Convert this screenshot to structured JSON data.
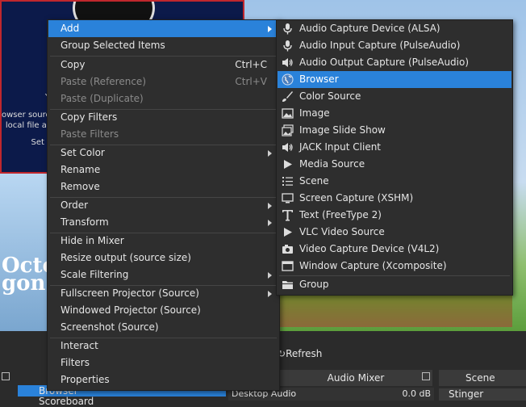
{
  "background": {
    "left_panel_lines": [
      "Y",
      "owser source",
      "local file ar",
      "Set t"
    ],
    "logo_lines": [
      "Octo",
      "gon"
    ],
    "refresh_label": "Refresh",
    "audio_mixer_title": "Audio Mixer",
    "scene_transitions_title": "Scene Transiti",
    "sources": [
      "Browser",
      "Scoreboard"
    ],
    "desktop_audio": {
      "label": "Desktop Audio",
      "level": "0.0 dB"
    },
    "transition_selected": "Stinger"
  },
  "context_menu": {
    "items": [
      {
        "label": "Add",
        "submenu": true,
        "highlighted": true
      },
      {
        "label": "Group Selected Items"
      },
      {
        "label": "Copy",
        "shortcut": "Ctrl+C"
      },
      {
        "label": "Paste (Reference)",
        "shortcut": "Ctrl+V",
        "disabled": true
      },
      {
        "label": "Paste (Duplicate)",
        "disabled": true
      },
      {
        "label": "Copy Filters"
      },
      {
        "label": "Paste Filters",
        "disabled": true
      },
      {
        "label": "Set Color",
        "submenu": true
      },
      {
        "label": "Rename"
      },
      {
        "label": "Remove"
      },
      {
        "label": "Order",
        "submenu": true
      },
      {
        "label": "Transform",
        "submenu": true
      },
      {
        "label": "Hide in Mixer"
      },
      {
        "label": "Resize output (source size)"
      },
      {
        "label": "Scale Filtering",
        "submenu": true
      },
      {
        "label": "Fullscreen Projector (Source)",
        "submenu": true
      },
      {
        "label": "Windowed Projector (Source)"
      },
      {
        "label": "Screenshot (Source)"
      },
      {
        "label": "Interact"
      },
      {
        "label": "Filters"
      },
      {
        "label": "Properties"
      }
    ]
  },
  "add_submenu": {
    "items": [
      {
        "label": "Audio Capture Device (ALSA)",
        "icon": "microphone-icon"
      },
      {
        "label": "Audio Input Capture (PulseAudio)",
        "icon": "microphone-icon"
      },
      {
        "label": "Audio Output Capture (PulseAudio)",
        "icon": "speaker-icon"
      },
      {
        "label": "Browser",
        "icon": "globe-icon",
        "highlighted": true
      },
      {
        "label": "Color Source",
        "icon": "brush-icon"
      },
      {
        "label": "Image",
        "icon": "image-icon"
      },
      {
        "label": "Image Slide Show",
        "icon": "slideshow-icon"
      },
      {
        "label": "JACK Input Client",
        "icon": "speaker-icon"
      },
      {
        "label": "Media Source",
        "icon": "play-icon"
      },
      {
        "label": "Scene",
        "icon": "list-icon"
      },
      {
        "label": "Screen Capture (XSHM)",
        "icon": "monitor-icon"
      },
      {
        "label": "Text (FreeType 2)",
        "icon": "text-icon"
      },
      {
        "label": "VLC Video Source",
        "icon": "play-icon"
      },
      {
        "label": "Video Capture Device (V4L2)",
        "icon": "camera-icon"
      },
      {
        "label": "Window Capture (Xcomposite)",
        "icon": "window-icon"
      },
      {
        "label": "Group",
        "icon": "folder-icon"
      }
    ]
  },
  "colors": {
    "highlight": "#2a82da",
    "menu_bg": "#2e2e2e",
    "border_red": "#c0272d"
  }
}
